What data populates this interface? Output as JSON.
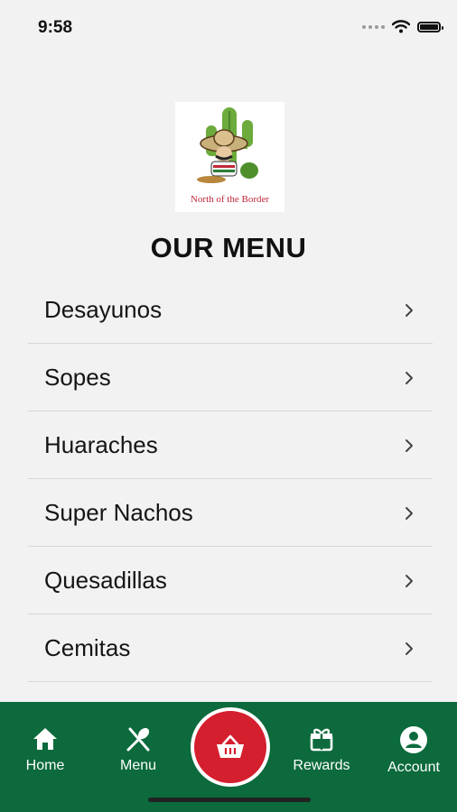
{
  "status_bar": {
    "time": "9:58"
  },
  "logo": {
    "caption": "North of the Border"
  },
  "page": {
    "title": "OUR MENU"
  },
  "menu": {
    "items": [
      {
        "label": "Desayunos"
      },
      {
        "label": "Sopes"
      },
      {
        "label": "Huaraches"
      },
      {
        "label": "Super Nachos"
      },
      {
        "label": "Quesadillas"
      },
      {
        "label": "Cemitas"
      }
    ]
  },
  "tab_bar": {
    "home": "Home",
    "menu": "Menu",
    "rewards": "Rewards",
    "account": "Account"
  },
  "icons": {
    "menu_item": "chevron-right-icon",
    "home": "home-icon",
    "menu": "utensils-icon",
    "cart": "basket-icon",
    "rewards": "gift-icon",
    "account": "account-icon"
  },
  "colors": {
    "tab_bar": "#0c6a3c",
    "cart_button": "#d41f2e",
    "background": "#f2f2f2"
  }
}
